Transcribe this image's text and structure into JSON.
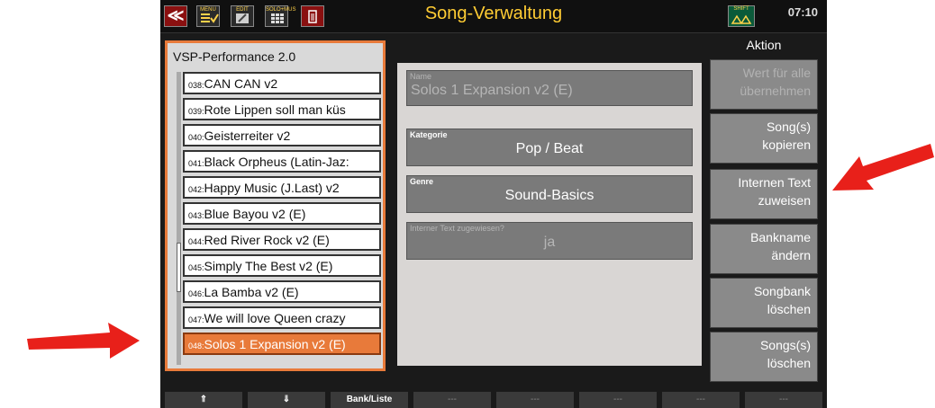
{
  "header": {
    "back_icon_text": "≪",
    "menu_label": "MENU",
    "edit_label": "EDIT",
    "grid_label": "SOLO+MUS",
    "shift_label": "SHIFT",
    "title": "Song-Verwaltung",
    "clock": "07:10"
  },
  "bank": {
    "title": "VSP-Performance 2.0",
    "songs": [
      {
        "num": "038:",
        "name": "CAN CAN v2"
      },
      {
        "num": "039:",
        "name": "Rote Lippen soll man küs"
      },
      {
        "num": "040:",
        "name": "Geisterreiter v2"
      },
      {
        "num": "041:",
        "name": "Black Orpheus (Latin-Jaz:"
      },
      {
        "num": "042:",
        "name": "Happy Music (J.Last) v2"
      },
      {
        "num": "043:",
        "name": "Blue Bayou v2 (E)"
      },
      {
        "num": "044:",
        "name": "Red River Rock v2 (E)"
      },
      {
        "num": "045:",
        "name": "Simply The Best v2 (E)"
      },
      {
        "num": "046:",
        "name": "La Bamba v2 (E)"
      },
      {
        "num": "047:",
        "name": "We will love Queen crazy"
      },
      {
        "num": "048:",
        "name": "Solos 1 Expansion v2 (E)"
      }
    ],
    "selected_index": 10
  },
  "details": {
    "name_label": "Name",
    "name_value": "Solos 1 Expansion v2 (E)",
    "kategorie_label": "Kategorie",
    "kategorie_value": "Pop / Beat",
    "genre_label": "Genre",
    "genre_value": "Sound-Basics",
    "intern_label": "Interner Text zugewiesen?",
    "intern_value": "ja"
  },
  "aktion": {
    "title": "Aktion",
    "wert": "Wert für alle\nübernehmen",
    "kopieren": "Song(s)\nkopieren",
    "text_zuweisen": "Internen Text\nzuweisen",
    "bankname": "Bankname\nändern",
    "songbank_loeschen": "Songbank\nlöschen",
    "songs_loeschen": "Songs(s)\nlöschen"
  },
  "footer": {
    "up": "⇑",
    "down": "⇓",
    "bank_liste": "Bank/Liste",
    "dash": "---"
  },
  "colors": {
    "accent_orange": "#e87a3a",
    "title_yellow": "#ffcc33",
    "arrow_red": "#e8201a"
  }
}
